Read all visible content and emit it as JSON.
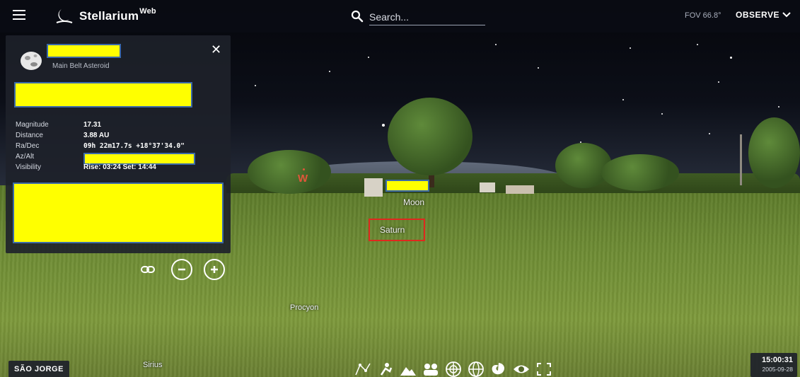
{
  "app": {
    "name": "Stellarium",
    "name_sup": "Web"
  },
  "search": {
    "placeholder": "Search..."
  },
  "header": {
    "fov": "FOV 66.8°",
    "observe_label": "OBSERVE"
  },
  "info_panel": {
    "object_type": "Main Belt Asteroid",
    "rows": [
      {
        "label": "Magnitude",
        "value": "17.31"
      },
      {
        "label": "Distance",
        "value": "3.88 AU"
      },
      {
        "label": "Ra/Dec",
        "value": "09h 22m17.7s  +18°37'34.0\""
      },
      {
        "label": "Az/Alt",
        "value": ""
      },
      {
        "label": "Visibility",
        "value": "Rise: 03:24   Set: 14:44"
      }
    ]
  },
  "sky_labels": {
    "moon": "Moon",
    "saturn": "Saturn",
    "procyon": "Procyon",
    "sirius": "Sirius",
    "west": "W"
  },
  "location": {
    "name": "SÃO JORGE"
  },
  "clock": {
    "time": "15:00:31",
    "date": "2005-09-28"
  },
  "toolbar": {
    "icons": [
      "constellation-lines-icon",
      "constellation-art-icon",
      "landscape-icon",
      "atmosphere-icon",
      "azimuthal-grid-icon",
      "equatorial-grid-icon",
      "nebulae-icon",
      "planets-eye-icon",
      "fullscreen-icon"
    ]
  },
  "colors": {
    "accent_red": "#e0281e",
    "redaction": "#ffff00",
    "cardinal": "#e0563a"
  }
}
